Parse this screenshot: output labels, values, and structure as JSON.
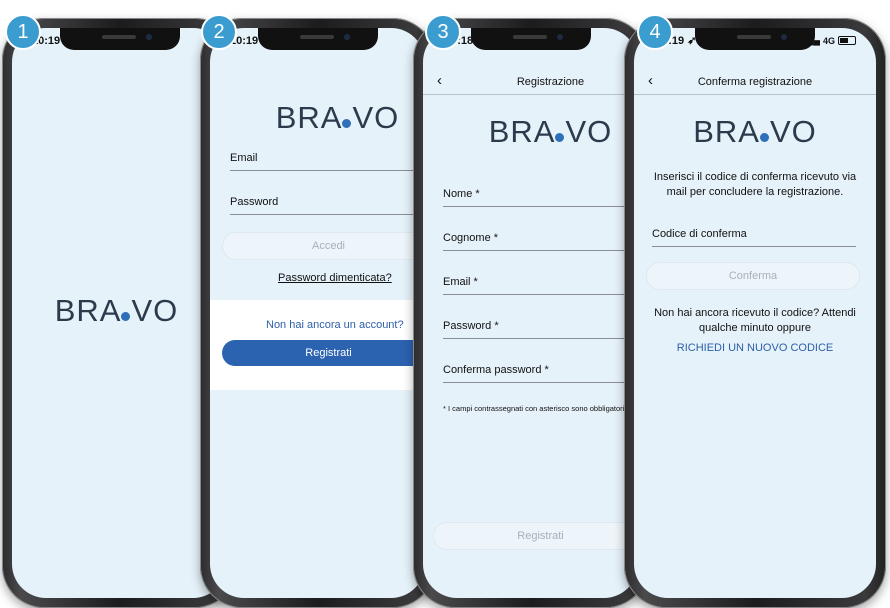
{
  "badges": [
    "1",
    "2",
    "3",
    "4"
  ],
  "phone1": {
    "time": "10:19 ➶",
    "logo_left": "BRA",
    "logo_right": "VO"
  },
  "phone2": {
    "time": "10:19 ➶",
    "logo_left": "BRA",
    "logo_right": "VO",
    "email_label": "Email",
    "password_label": "Password",
    "login_button": "Accedi",
    "forgot_password": "Password dimenticata?",
    "no_account": "Non hai ancora un account?",
    "register_button": "Registrati"
  },
  "phone3": {
    "time": "10:18 ➶",
    "back_icon": "chevron-left-icon",
    "title": "Registrazione",
    "logo_left": "BRA",
    "logo_right": "VO",
    "fields": [
      "Nome *",
      "Cognome *",
      "Email *",
      "Password *",
      "Conferma password *"
    ],
    "note": "* I campi contrassegnati con asterisco sono obbligatori.",
    "register_button": "Registrati"
  },
  "phone4": {
    "time": "10:19 ➶",
    "signal": "4G",
    "back_icon": "chevron-left-icon",
    "title": "Conferma registrazione",
    "logo_left": "BRA",
    "logo_right": "VO",
    "instructions": "Inserisci il codice di conferma ricevuto via mail per concludere la registrazione.",
    "code_label": "Codice di conferma",
    "confirm_button": "Conferma",
    "not_received": "Non hai ancora ricevuto il codice? Attendi qualche minuto oppure",
    "resend_link": "RICHIEDI UN NUOVO CODICE"
  },
  "colors": {
    "accent": "#2c63b1",
    "badge": "#3a9ccf",
    "screen_bg": "#e6f2fa"
  }
}
